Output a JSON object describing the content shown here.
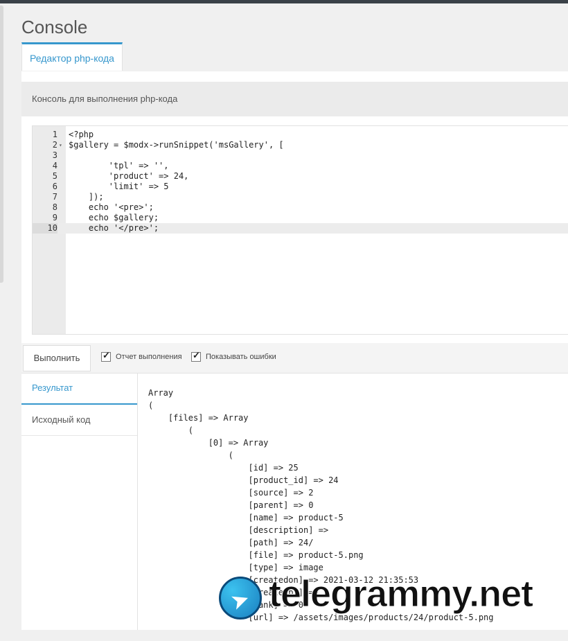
{
  "page_title": "Console",
  "tab_label": "Редактор php-кода",
  "description": "Консоль для выполнения php-кода",
  "editor": {
    "lines": [
      {
        "n": "1",
        "code": "<?php"
      },
      {
        "n": "2",
        "code": "$gallery = $modx->runSnippet('msGallery', ["
      },
      {
        "n": "3",
        "code": ""
      },
      {
        "n": "4",
        "code": "        'tpl' => '',"
      },
      {
        "n": "5",
        "code": "        'product' => 24,"
      },
      {
        "n": "6",
        "code": "        'limit' => 5"
      },
      {
        "n": "7",
        "code": "    ]);"
      },
      {
        "n": "8",
        "code": "    echo '<pre>';"
      },
      {
        "n": "9",
        "code": "    echo $gallery;"
      },
      {
        "n": "10",
        "code": "    echo '</pre>';"
      }
    ],
    "active_line": "10",
    "fold_marker": "▾"
  },
  "toolbar": {
    "run_label": "Выполнить",
    "report_label": "Отчет выполнения",
    "show_errors_label": "Показывать ошибки"
  },
  "side_tabs": {
    "result": "Результат",
    "source": "Исходный код"
  },
  "output_text": "Array\n(\n    [files] => Array\n        (\n            [0] => Array\n                (\n                    [id] => 25\n                    [product_id] => 24\n                    [source] => 2\n                    [parent] => 0\n                    [name] => product-5\n                    [description] => \n                    [path] => 24/\n                    [file] => product-5.png\n                    [type] => image\n                    [createdon] => 2021-03-12 21:35:53\n                    [createdby] => 1\n                    [rank] => 0\n                    [url] => /assets/images/products/24/product-5.png",
  "watermark": "telegrammy.net",
  "colors": {
    "accent": "#3697cd",
    "topbar": "#3a4148"
  }
}
